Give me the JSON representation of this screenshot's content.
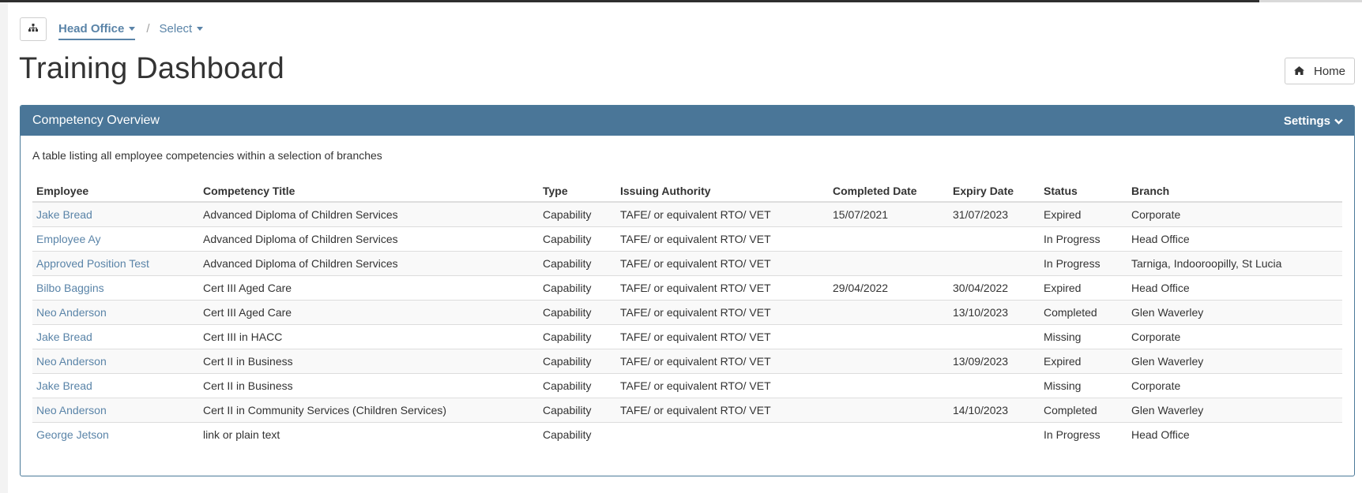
{
  "breadcrumb": {
    "sitemap_icon": "sitemap-icon",
    "items": [
      {
        "label": "Head Office",
        "active": true
      },
      {
        "label": "Select",
        "active": false
      }
    ],
    "separator": "/"
  },
  "page": {
    "title": "Training Dashboard",
    "home_button": {
      "label": "Home",
      "icon": "home-icon"
    }
  },
  "panel": {
    "title": "Competency Overview",
    "settings_label": "Settings",
    "settings_icon": "chevron-down-icon",
    "description": "A table listing all employee competencies within a selection of branches",
    "header_color": "#4a7698",
    "link_color": "#5a84a8"
  },
  "table": {
    "columns": [
      "Employee",
      "Competency Title",
      "Type",
      "Issuing Authority",
      "Completed Date",
      "Expiry Date",
      "Status",
      "Branch"
    ],
    "rows": [
      [
        "Jake Bread",
        "Advanced Diploma of Children Services",
        "Capability",
        "TAFE/ or equivalent RTO/ VET",
        "15/07/2021",
        "31/07/2023",
        "Expired",
        "Corporate"
      ],
      [
        "Employee Ay",
        "Advanced Diploma of Children Services",
        "Capability",
        "TAFE/ or equivalent RTO/ VET",
        "",
        "",
        "In Progress",
        "Head Office"
      ],
      [
        "Approved Position Test",
        "Advanced Diploma of Children Services",
        "Capability",
        "TAFE/ or equivalent RTO/ VET",
        "",
        "",
        "In Progress",
        "Tarniga, Indooroopilly, St Lucia"
      ],
      [
        "Bilbo Baggins",
        "Cert III Aged Care",
        "Capability",
        "TAFE/ or equivalent RTO/ VET",
        "29/04/2022",
        "30/04/2022",
        "Expired",
        "Head Office"
      ],
      [
        "Neo Anderson",
        "Cert III Aged Care",
        "Capability",
        "TAFE/ or equivalent RTO/ VET",
        "",
        "13/10/2023",
        "Completed",
        "Glen Waverley"
      ],
      [
        "Jake Bread",
        "Cert III in HACC",
        "Capability",
        "TAFE/ or equivalent RTO/ VET",
        "",
        "",
        "Missing",
        "Corporate"
      ],
      [
        "Neo Anderson",
        "Cert II in Business",
        "Capability",
        "TAFE/ or equivalent RTO/ VET",
        "",
        "13/09/2023",
        "Expired",
        "Glen Waverley"
      ],
      [
        "Jake Bread",
        "Cert II in Business",
        "Capability",
        "TAFE/ or equivalent RTO/ VET",
        "",
        "",
        "Missing",
        "Corporate"
      ],
      [
        "Neo Anderson",
        "Cert II in Community Services (Children Services)",
        "Capability",
        "TAFE/ or equivalent RTO/ VET",
        "",
        "14/10/2023",
        "Completed",
        "Glen Waverley"
      ],
      [
        "George Jetson",
        "link or plain text",
        "Capability",
        "",
        "",
        "",
        "In Progress",
        "Head Office"
      ]
    ]
  }
}
